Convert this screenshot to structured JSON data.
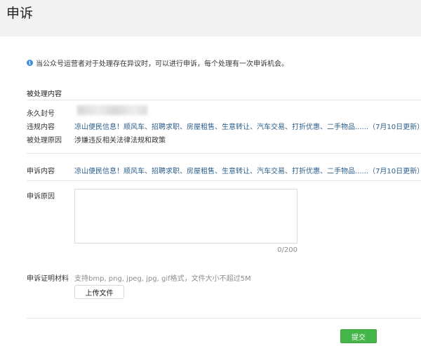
{
  "page": {
    "title": "申诉"
  },
  "notice": {
    "text": "当公众号运营者对于处理存在异议时，可以进行申诉，每个处理有一次申诉机会。"
  },
  "processed": {
    "section_title": "被处理内容",
    "rows": [
      {
        "label": "永久封号",
        "value": ""
      },
      {
        "label": "违规内容",
        "value": "凉山便民信息！顺风车、招聘求职、房屋租售、生意转让、汽车交易、打折优惠、二手物品......（7月10日更新）"
      },
      {
        "label": "被处理原因",
        "value": "涉嫌违反相关法律法规和政策"
      }
    ]
  },
  "appeal": {
    "content_label": "申诉内容",
    "content_value": "凉山便民信息！顺风车、招聘求职、房屋租售、生意转让、汽车交易、打折优惠、二手物品......（7月10日更新）",
    "reason_label": "申诉原因",
    "reason_value": "",
    "counter": "0/200",
    "evidence_label": "申诉证明材料",
    "evidence_hint": "支持bmp, png, jpeg, jpg, gif格式，文件大小不超过5M",
    "upload_label": "上传文件"
  },
  "footer": {
    "submit_label": "提交"
  },
  "colors": {
    "link": "#2c5f8d",
    "primary": "#44b549",
    "info": "#3c8ede"
  }
}
